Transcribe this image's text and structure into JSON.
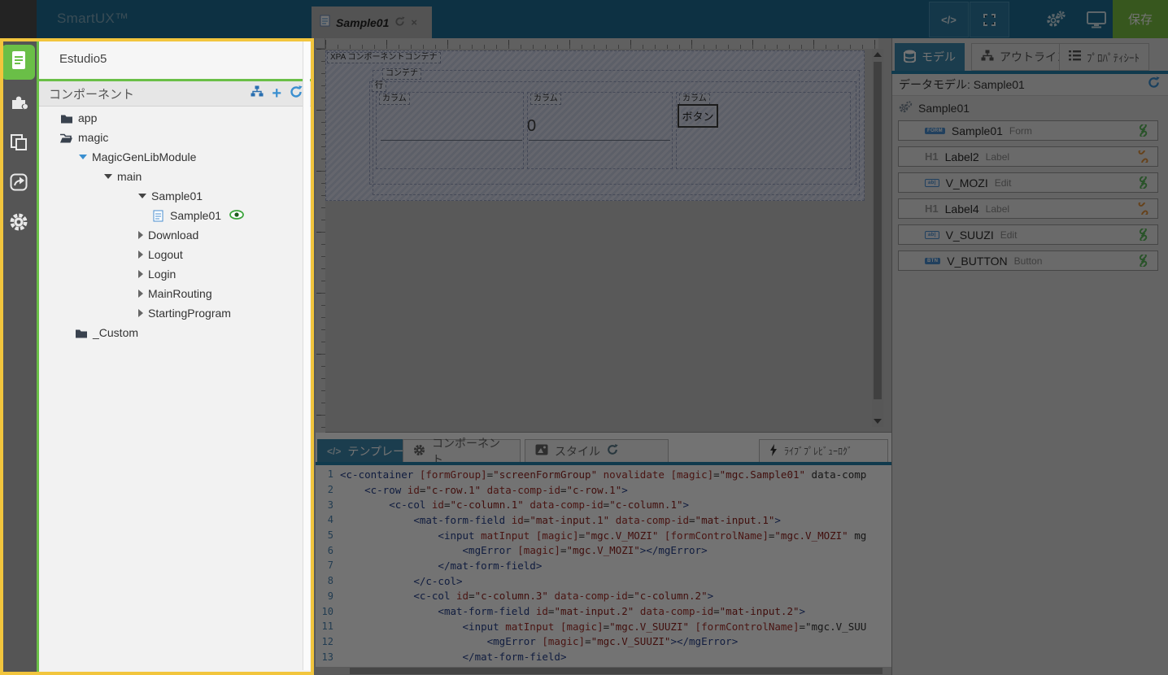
{
  "colors": {
    "accent_green": "#7ac143",
    "highlight_border": "#f2c53d",
    "topbar_teal": "#1d6d96",
    "tab_active_blue": "#3d87ad",
    "icon_blue": "#3a8fd0",
    "link_green": "#5cb85c",
    "link_broken_orange": "#e2923d"
  },
  "topbar": {
    "brand": "SmartUX™",
    "document_tab": {
      "title": "Sample01"
    },
    "save_label": "保存"
  },
  "sidebar": {
    "items": [
      {
        "name": "documents",
        "active": true
      },
      {
        "name": "plugins",
        "active": false
      },
      {
        "name": "copies",
        "active": false
      },
      {
        "name": "share",
        "active": false
      },
      {
        "name": "settings",
        "active": false
      }
    ]
  },
  "left_panel": {
    "title": "Estudio5",
    "section_title": "コンポーネント",
    "tree": [
      {
        "label": "app",
        "icon": "folder",
        "level": "a"
      },
      {
        "label": "magic",
        "icon": "folder-open",
        "level": "a"
      },
      {
        "label": "MagicGenLibModule",
        "arrow": "down",
        "arrow_blue": true,
        "level": "b"
      },
      {
        "label": "main",
        "arrow": "down",
        "level": "c"
      },
      {
        "label": "Sample01",
        "arrow": "down",
        "level": "d"
      },
      {
        "label": "Sample01",
        "icon": "document",
        "eye": true,
        "level": "e"
      },
      {
        "label": "Download",
        "arrow": "right",
        "level": "d"
      },
      {
        "label": "Logout",
        "arrow": "right",
        "level": "d"
      },
      {
        "label": "Login",
        "arrow": "right",
        "level": "d"
      },
      {
        "label": "MainRouting",
        "arrow": "right",
        "level": "d"
      },
      {
        "label": "StartingProgram",
        "arrow": "right",
        "level": "d"
      },
      {
        "label": "_Custom",
        "icon": "folder",
        "level": "f"
      }
    ]
  },
  "canvas": {
    "labels": {
      "xpa_container": "XPA コンポーネントコンテナ",
      "container": "コンテナ",
      "row": "行",
      "column": "カラム"
    },
    "input2_value": "0",
    "button_label": "ボタン"
  },
  "bottom_panel": {
    "tabs": {
      "template": "テンプレート",
      "component": "コンポーネント",
      "style": "スタイル",
      "live_preview_log": "ﾗｲﾌﾞﾌﾟﾚﾋﾞｭｰﾛｸﾞ"
    },
    "code_lines": [
      "<c-container [formGroup]=\"screenFormGroup\" novalidate [magic]=\"mgc.Sample01\" data-comp",
      "    <c-row id=\"c-row.1\" data-comp-id=\"c-row.1\">",
      "        <c-col id=\"c-column.1\" data-comp-id=\"c-column.1\">",
      "            <mat-form-field id=\"mat-input.1\" data-comp-id=\"mat-input.1\">",
      "                <input matInput [magic]=\"mgc.V_MOZI\" [formControlName]=\"mgc.V_MOZI\" mg",
      "                    <mgError [magic]=\"mgc.V_MOZI\"></mgError>",
      "                </mat-form-field>",
      "            </c-col>",
      "            <c-col id=\"c-column.3\" data-comp-id=\"c-column.2\">",
      "                <mat-form-field id=\"mat-input.2\" data-comp-id=\"mat-input.2\">",
      "                    <input matInput [magic]=\"mgc.V_SUUZI\" [formControlName]=\"mgc.V_SUU",
      "                        <mgError [magic]=\"mgc.V_SUUZI\"></mgError>",
      "                    </mat-form-field>",
      "                </c-col>"
    ]
  },
  "right_panel": {
    "tabs": {
      "model": "モデル",
      "outline": "アウトライン",
      "property_sheet": "ﾌﾟﾛﾊﾟﾃｨｼｰﾄ"
    },
    "data_model_header": "データモデル: Sample01",
    "group_name": "Sample01",
    "items": [
      {
        "icon": "form",
        "name": "Sample01",
        "type": "Form",
        "linked": true
      },
      {
        "icon": "label",
        "name": "Label2",
        "type": "Label",
        "linked": false
      },
      {
        "icon": "edit",
        "name": "V_MOZI",
        "type": "Edit",
        "linked": true
      },
      {
        "icon": "label",
        "name": "Label4",
        "type": "Label",
        "linked": false
      },
      {
        "icon": "edit",
        "name": "V_SUUZI",
        "type": "Edit",
        "linked": true
      },
      {
        "icon": "button",
        "name": "V_BUTTON",
        "type": "Button",
        "linked": true
      }
    ]
  }
}
